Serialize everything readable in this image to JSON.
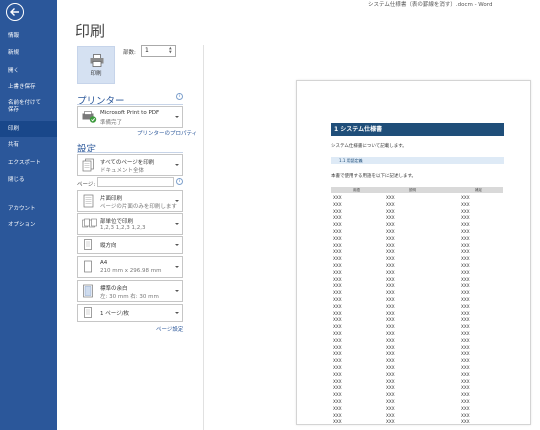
{
  "window": {
    "title": "システム仕様書（表の罫線を消す）.docm - Word"
  },
  "colors": {
    "sidebar": "#2b579a",
    "accent": "#2b579a",
    "doc_heading": "#1f4e79"
  },
  "sidebar": {
    "back_icon": "back-arrow-icon",
    "items": [
      {
        "label": "情報"
      },
      {
        "label": "新規"
      },
      {
        "label": "開く"
      },
      {
        "label": "上書き保存"
      },
      {
        "label": "名前を付けて\n保存"
      },
      {
        "label": "印刷",
        "active": true
      },
      {
        "label": "共有"
      },
      {
        "label": "エクスポート"
      },
      {
        "label": "閉じる"
      },
      {
        "label": "アカウント"
      },
      {
        "label": "オプション"
      }
    ]
  },
  "print_panel": {
    "title": "印刷",
    "print_button_label": "印刷",
    "copies_label": "部数:",
    "copies_value": "1"
  },
  "printer": {
    "section_title": "プリンター",
    "name": "Microsoft Print to PDF",
    "status": "準備完了",
    "properties_link": "プリンターのプロパティ"
  },
  "settings": {
    "section_title": "設定",
    "pages_label": "ページ:",
    "pages_value": "",
    "page_setup_link": "ページ設定",
    "options": [
      {
        "icon": "pages-icon",
        "line1": "すべてのページを印刷",
        "line2": "ドキュメント全体"
      },
      {
        "icon": "one-side-icon",
        "line1": "片面印刷",
        "line2": "ページの片面のみを印刷します"
      },
      {
        "icon": "collate-icon",
        "line1": "部単位で印刷",
        "line2": "1,2,3    1,2,3    1,2,3"
      },
      {
        "icon": "portrait-icon",
        "line1": "縦方向",
        "line2": ""
      },
      {
        "icon": "paper-size-icon",
        "line1": "A4",
        "line2": "210 mm x 296.98 mm"
      },
      {
        "icon": "margins-icon",
        "line1": "標準の余白",
        "line2": "左:  30 mm    右:  30 mm"
      },
      {
        "icon": "pages-per-sheet-icon",
        "line1": "1 ページ/枚",
        "line2": ""
      }
    ]
  },
  "preview": {
    "heading": "1  システム仕様書",
    "intro": "システム仕様書について記載します。",
    "subheading": "1.1  用語定義",
    "description": "本書で使用する用語を以下に記述します。",
    "table_headers": [
      "用語",
      "説明",
      "補足"
    ],
    "cell_value": "XXX",
    "row_count": 34
  }
}
